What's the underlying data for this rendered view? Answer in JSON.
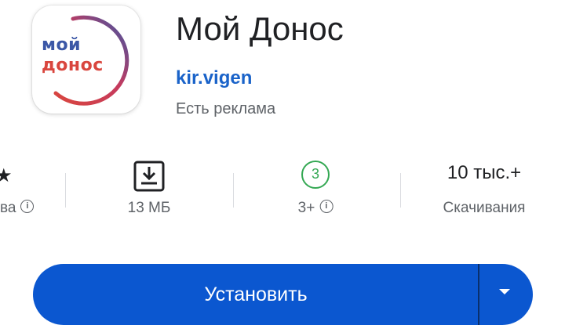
{
  "app": {
    "icon_line1": "мой",
    "icon_line2": "донос",
    "title": "Мой Донос",
    "developer": "kir.vigen",
    "ads_notice": "Есть реклама"
  },
  "stats": {
    "rating_label": "ва",
    "size_value": "13 МБ",
    "age_badge": "3",
    "age_value": "3+",
    "downloads_value": "10 тыс.+",
    "downloads_label": "Скачивания"
  },
  "actions": {
    "install_label": "Установить"
  },
  "colors": {
    "accent": "#0b57d0",
    "developer_link": "#1a63c9",
    "age_green": "#34a853",
    "icon_blue": "#3b57a6",
    "icon_red": "#d9463e"
  },
  "icons": [
    "star-icon",
    "info-icon",
    "download-icon",
    "chevron-down-icon"
  ]
}
